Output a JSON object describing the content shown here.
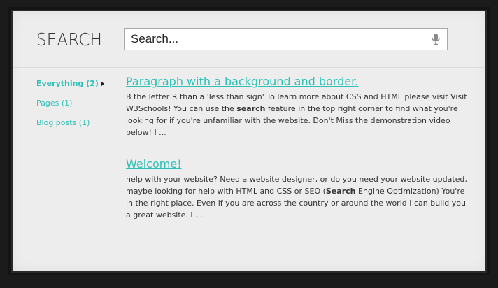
{
  "header": {
    "title": "SEARCH",
    "search": {
      "value": "",
      "placeholder": "Search..."
    }
  },
  "sidebar": {
    "items": [
      {
        "label": "Everything (2)",
        "active": true
      },
      {
        "label": "Pages (1)",
        "active": false
      },
      {
        "label": "Blog posts (1)",
        "active": false
      }
    ]
  },
  "results": [
    {
      "title": "Paragraph with a background and border.",
      "snippet_parts": [
        "B the letter R than a 'less than sign' To learn more about CSS and HTML please visit Visit W3Schools! You can use the ",
        "search",
        " feature in the top right corner to find what you're looking for if you're unfamiliar with the website. Don't Miss the demonstration video below! I ..."
      ]
    },
    {
      "title": "Welcome!",
      "snippet_parts": [
        "help with your website? Need a website designer, or do you need your website updated, maybe looking for help with HTML and CSS or SEO (",
        "Search",
        " Engine Optimization) You're in the right place. Even if you are across the country or around the world I can build you a great website. I ..."
      ]
    }
  ],
  "colors": {
    "accent": "#2fc0b7",
    "panel": "#ededed",
    "background": "#1b1b1b"
  },
  "icons": {
    "search_box": "microphone-icon",
    "sidebar_active": "triangle-right-icon"
  }
}
